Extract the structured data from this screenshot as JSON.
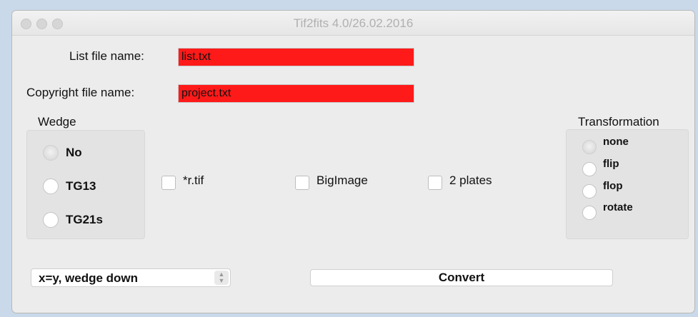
{
  "window": {
    "title": "Tif2fits 4.0/26.02.2016"
  },
  "files": {
    "list_label": "List file name:",
    "list_value": "list.txt",
    "copyright_label": "Copyright file name:",
    "copyright_value": "project.txt",
    "field_color": "#ff1a1a"
  },
  "wedge": {
    "label": "Wedge",
    "options": [
      "No",
      "TG13",
      "TG21s"
    ],
    "selected": "No"
  },
  "options": {
    "rtif_label": "*r.tif",
    "bigimage_label": "BigImage",
    "plates_label": "2 plates"
  },
  "transformation": {
    "label": "Transformation",
    "options": [
      "none",
      "flip",
      "flop",
      "rotate"
    ],
    "selected": "none"
  },
  "mode_select": {
    "value": "x=y, wedge down"
  },
  "convert_button": {
    "label": "Convert"
  }
}
